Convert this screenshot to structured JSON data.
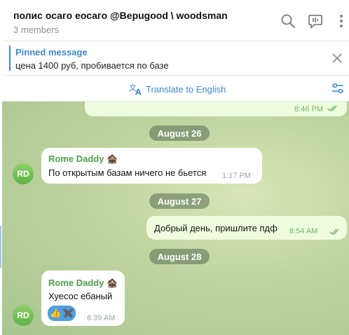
{
  "header": {
    "title": "полис осаго еосаго @Bepugood \\ woodsman",
    "subtitle": "3 members",
    "icons": [
      "search-icon",
      "live-chat-icon",
      "more-icon"
    ]
  },
  "pinned": {
    "label": "Pinned message",
    "text": "цена 1400 руб, пробивается по базе",
    "close_icon": "close-icon"
  },
  "translate": {
    "label": "Translate to English",
    "icon": "translate-icon",
    "settings_icon": "settings-sliders-icon"
  },
  "chat": {
    "messages": [
      {
        "kind": "outgoing",
        "time": "8:46 PM",
        "read": true
      },
      {
        "kind": "date",
        "text": "August 26"
      },
      {
        "kind": "incoming",
        "sender": "Rome Daddy",
        "avatar": "RD",
        "text": "По открытым базам ничего не бьется",
        "time": "1:17 PM"
      },
      {
        "kind": "date",
        "text": "August 27"
      },
      {
        "kind": "outgoing",
        "text": "Добрый день, пришлите пдф",
        "time": "8:54 AM",
        "read": true
      },
      {
        "kind": "date",
        "text": "August 28"
      },
      {
        "kind": "incoming",
        "sender": "Rome Daddy",
        "avatar": "RD",
        "text": "Хуесос ебаный",
        "time": "6:39 AM",
        "reactions": [
          "👍",
          "✖️"
        ]
      }
    ]
  },
  "colors": {
    "accent": "#3e88c7",
    "sender": "#4fa04a",
    "outgoing_bubble": "#effdde",
    "chat_background": "#bfd39e"
  }
}
